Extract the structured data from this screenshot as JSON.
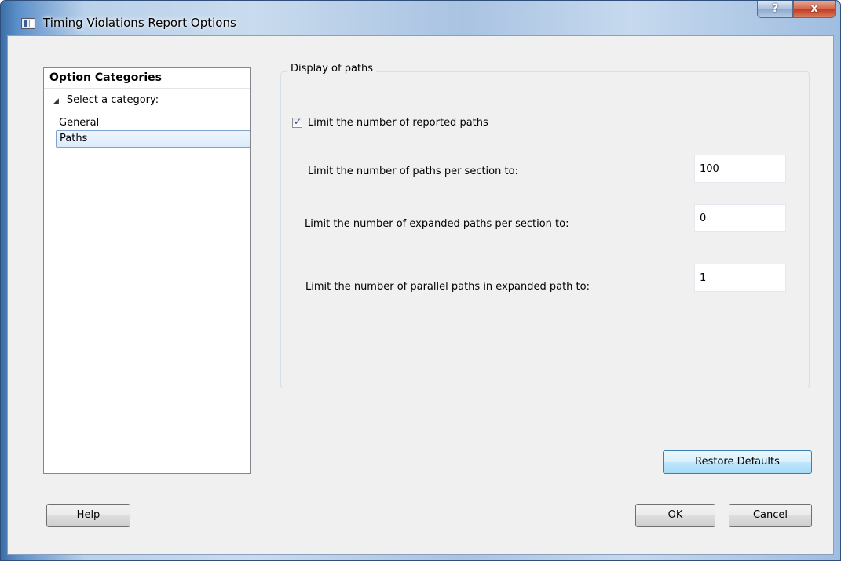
{
  "window": {
    "title": "Timing Violations Report Options",
    "help_glyph": "?",
    "close_glyph": "x"
  },
  "categories": {
    "header": "Option Categories",
    "root": "Select a category:",
    "items": [
      "General",
      "Paths"
    ],
    "selected": "Paths"
  },
  "display": {
    "group_title": "Display of paths",
    "limit_checkbox": {
      "label": "Limit the number of reported paths",
      "checked": true
    },
    "fields": [
      {
        "label": "Limit the number of paths per section to:",
        "value": "100"
      },
      {
        "label": "Limit the number of expanded paths per section to:",
        "value": "0"
      },
      {
        "label": "Limit the number of parallel paths in expanded path  to:",
        "value": "1"
      }
    ]
  },
  "buttons": {
    "restore": "Restore Defaults",
    "help": "Help",
    "ok": "OK",
    "cancel": "Cancel"
  }
}
